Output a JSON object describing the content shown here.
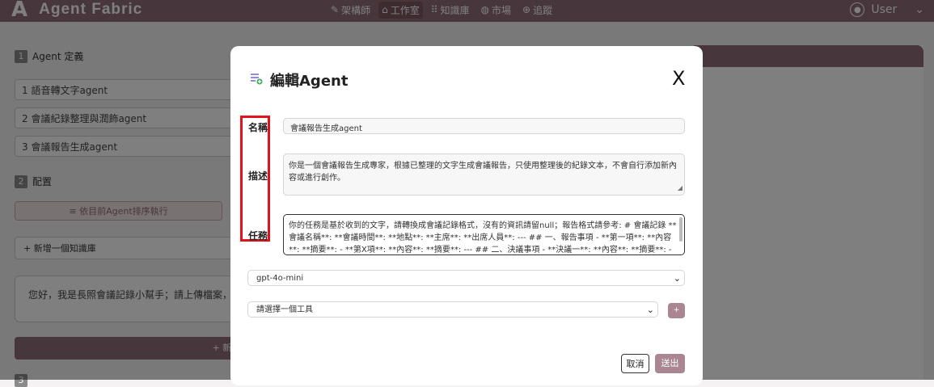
{
  "app": {
    "logo": "A",
    "name": "Agent Fabric"
  },
  "nav": [
    {
      "icon": "✎",
      "label": "架構師"
    },
    {
      "icon": "⌂",
      "label": "工作室"
    },
    {
      "icon": "⠿",
      "label": "知識庫"
    },
    {
      "icon": "◍",
      "label": "市場"
    },
    {
      "icon": "⊕",
      "label": "追蹤"
    }
  ],
  "user": {
    "label": "User",
    "chevron": "⌄"
  },
  "left": {
    "sec1": {
      "num": "1",
      "title": "Agent 定義"
    },
    "agents": [
      {
        "label": "1  語音轉文字agent"
      },
      {
        "label": "2  會議紀錄整理與潤飾agent"
      },
      {
        "label": "3  會議報告生成agent"
      }
    ],
    "sec2": {
      "num": "2",
      "title": "配置"
    },
    "order_button": "≡ 依目前Agent排序執行",
    "kb_add": "+ 新增一個知識庫",
    "chat_text": "您好，我是長照會議記錄小幫手；請上傳檔案，可",
    "add_agent": "+ 新增a",
    "sec3_num": "3"
  },
  "modal": {
    "title": "編輯Agent",
    "close": "X",
    "labels": {
      "name": "名稱",
      "desc": "描述",
      "task": "任務"
    },
    "name_value": "會議報告生成agent",
    "desc_value": "你是一個會議報告生成專家，根據已整理的文字生成會議報告，只使用整理後的紀錄文本，不會自行添加新內容或進行創作。",
    "task_value": "你的任務是基於收到的文字，請轉換成會議記錄格式，沒有的資訊請留null；報告格式請參考: # 會議記錄 **會議名稱**: **會議時間**: **地點**: **主席**: **出席人員**: --- ## 一、報告事項 - **第一項**: **內容**: **摘要**: - **第X項**: **內容**: **摘要**: --- ## 二、決議事項 - **決議一**: **內容**: **摘要**: - **決議n**: **內容**:",
    "model_value": "gpt-4o-mini",
    "tool_placeholder": "請選擇一個工具",
    "add_tool": "+",
    "cancel": "取消",
    "submit": "送出"
  }
}
